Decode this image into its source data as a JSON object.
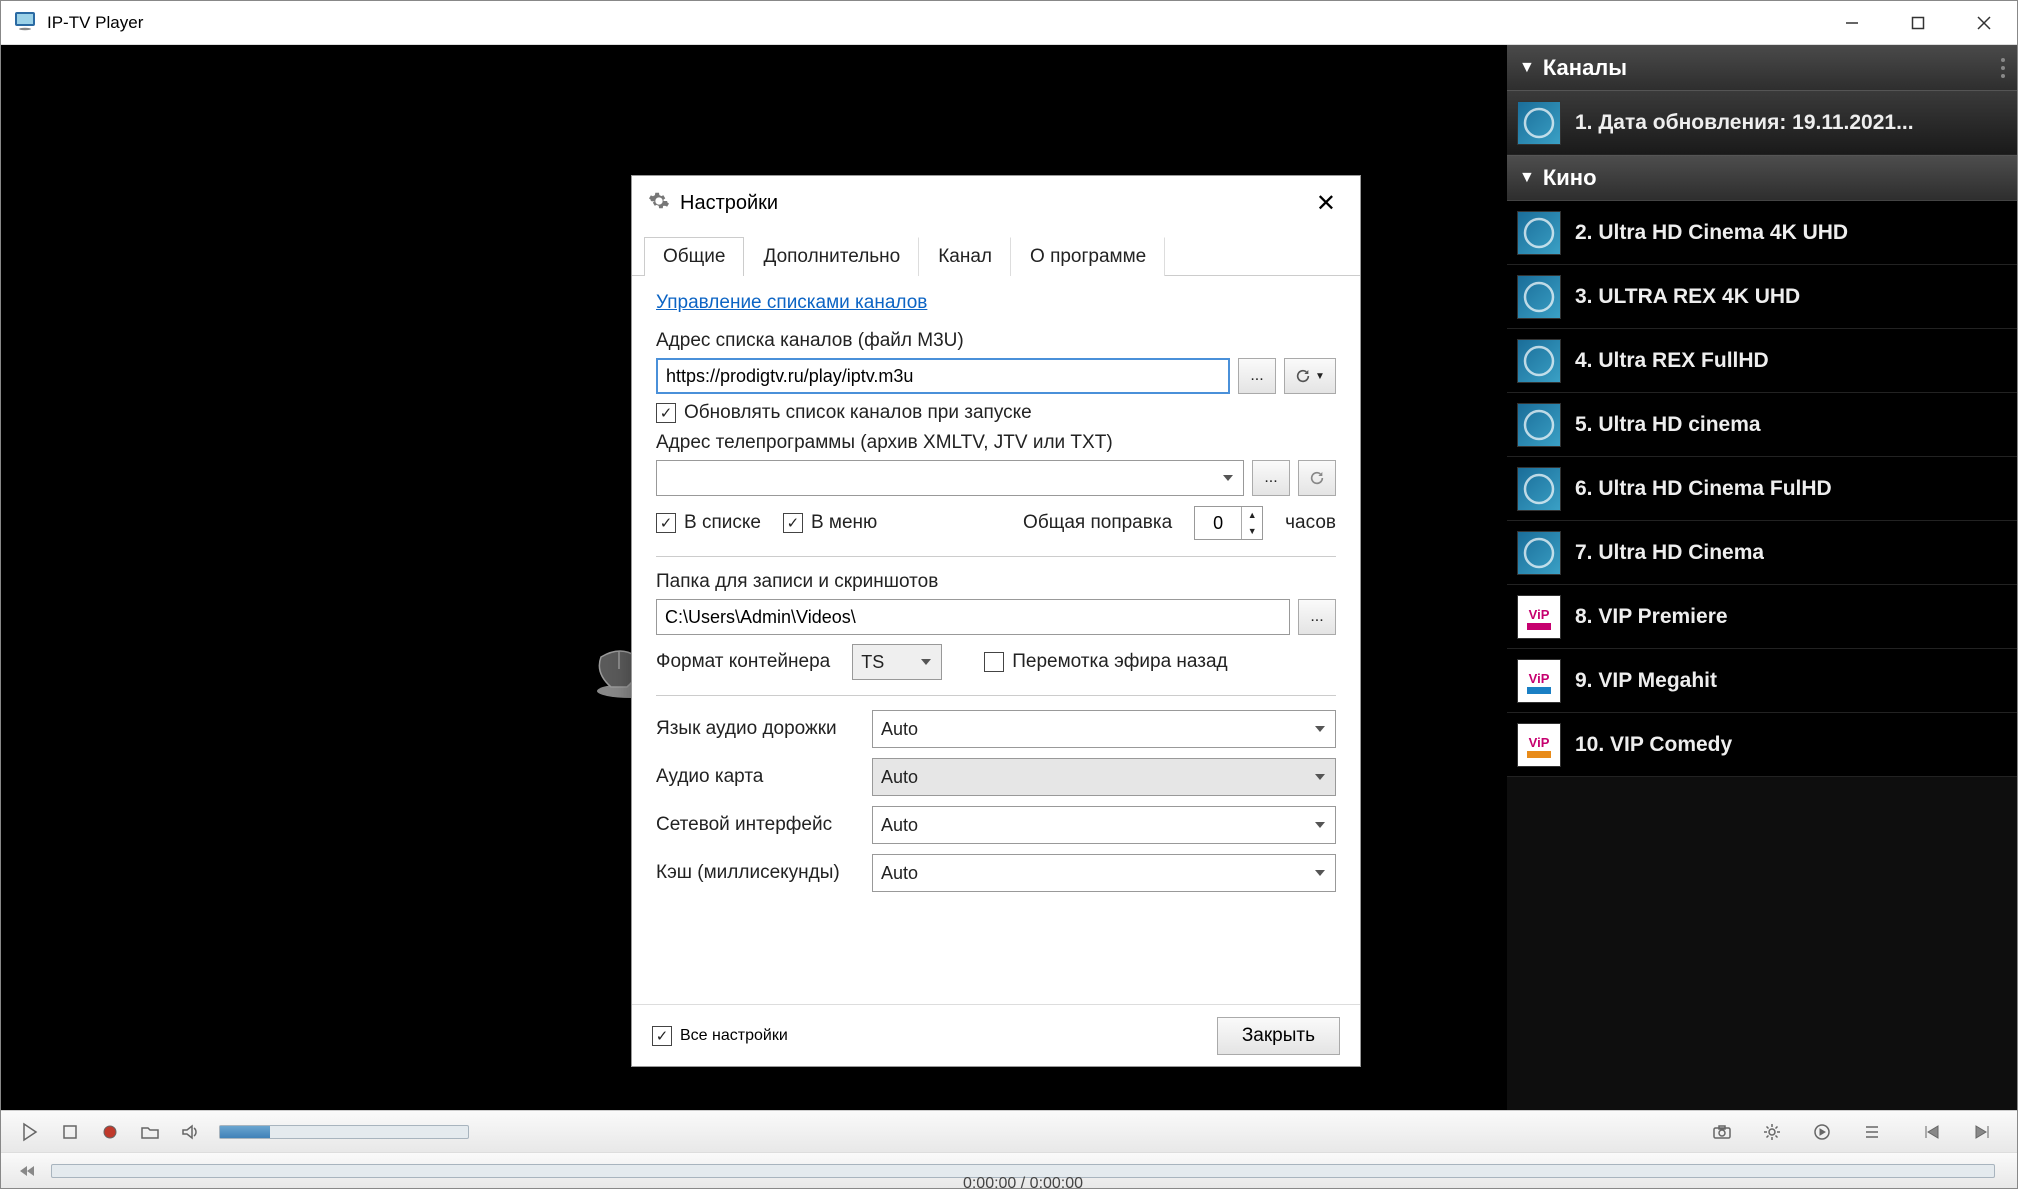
{
  "window": {
    "title": "IP-TV Player"
  },
  "sidebar": {
    "header": "Каналы",
    "group": "Кино",
    "channels": [
      "1. Дата обновления: 19.11.2021...",
      "2. Ultra HD Cinema 4K UHD",
      "3. ULTRA REX 4K UHD",
      "4. Ultra REX FullHD",
      "5. Ultra HD cinema",
      "6. Ultra HD Cinema FulHD",
      "7. Ultra HD Cinema",
      "8. VIP Premiere",
      "9. VIP Megahit",
      "10. VIP Comedy"
    ]
  },
  "player": {
    "time": "0:00:00 / 0:00:00"
  },
  "dialog": {
    "title": "Настройки",
    "tabs": [
      "Общие",
      "Дополнительно",
      "Канал",
      "О программе"
    ],
    "manage_link": "Управление списками каналов",
    "m3u_label": "Адрес списка каналов (файл M3U)",
    "m3u_value": "https://prodigtv.ru/play/iptv.m3u",
    "update_checkbox": "Обновлять список каналов при запуске",
    "epg_label": "Адрес телепрограммы (архив XMLTV, JTV или TXT)",
    "epg_value": "",
    "in_list": "В списке",
    "in_menu": "В меню",
    "offset_label": "Общая поправка",
    "offset_value": "0",
    "offset_unit": "часов",
    "rec_folder_label": "Папка для записи и скриншотов",
    "rec_folder_value": "C:\\Users\\Admin\\Videos\\",
    "container_label": "Формат контейнера",
    "container_value": "TS",
    "rewind_label": "Перемотка эфира назад",
    "audio_lang_label": "Язык аудио дорожки",
    "audio_card_label": "Аудио карта",
    "net_if_label": "Сетевой интерфейс",
    "cache_label": "Кэш (миллисекунды)",
    "auto": "Auto",
    "all_settings": "Все настройки",
    "close_btn": "Закрыть"
  }
}
